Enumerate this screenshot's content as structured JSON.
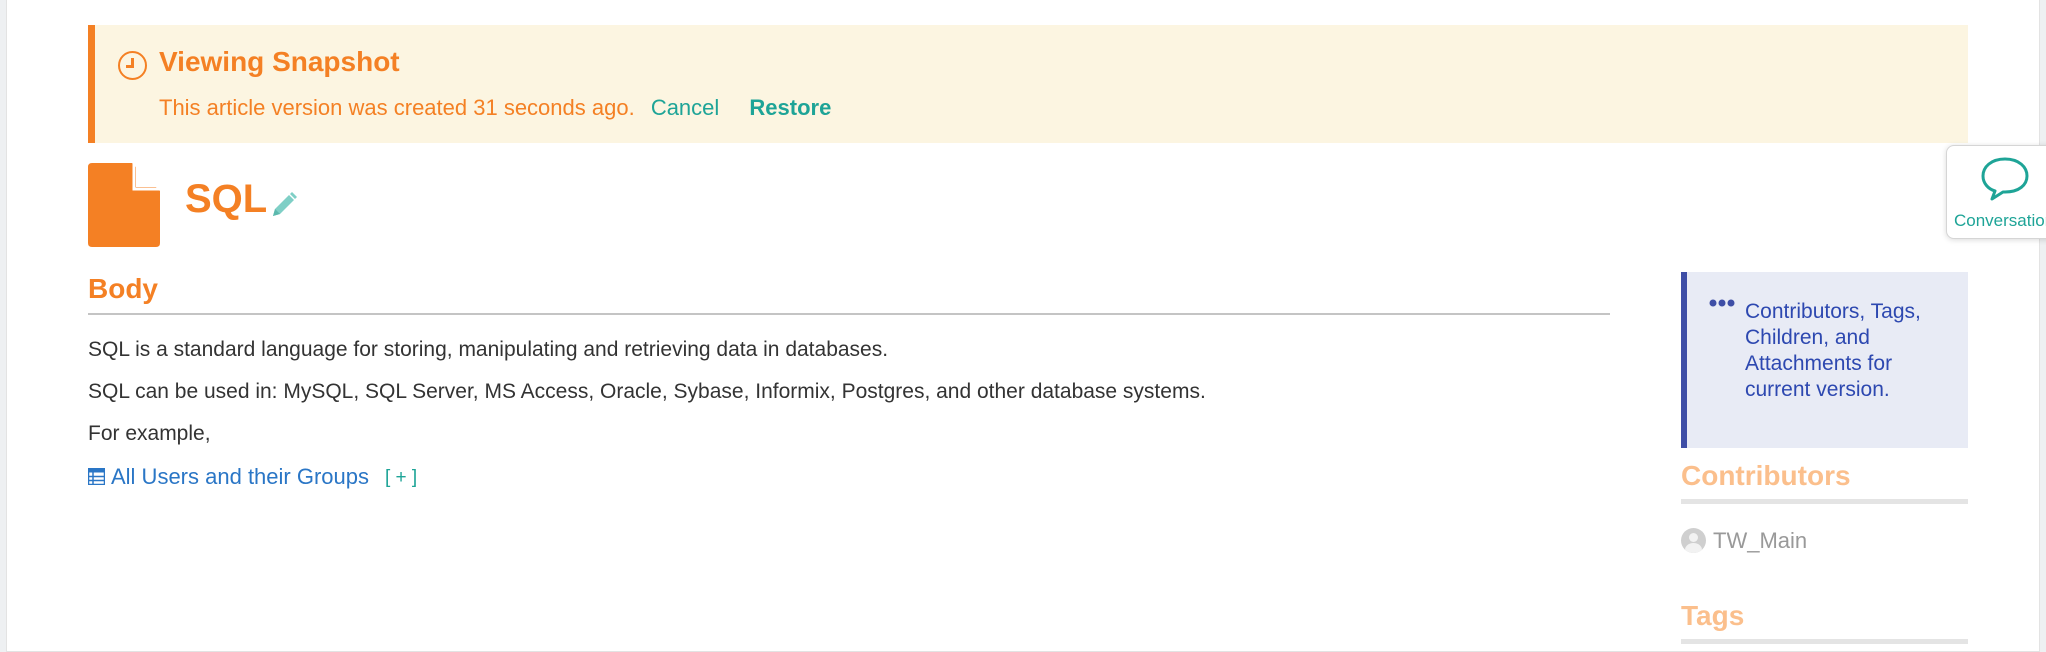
{
  "snapshot_banner": {
    "title": "Viewing Snapshot",
    "message": "This article version was created 31 seconds ago.",
    "cancel_label": "Cancel",
    "restore_label": "Restore",
    "icon": "clock-icon"
  },
  "article": {
    "title": "SQL",
    "type_icon": "document-icon",
    "edit_icon": "pencil-icon",
    "body_heading": "Body",
    "paragraphs": [
      "SQL is a standard language for storing, manipulating and retrieving data in databases.",
      "SQL can be used in: MySQL, SQL Server, MS Access, Oracle, Sybase, Informix, Postgres, and other database systems.",
      "For example,"
    ],
    "embedded_table": {
      "label": "All Users and their Groups",
      "toggle_label": "[ + ]",
      "icon": "table-icon"
    }
  },
  "sidebar": {
    "info_text": "Contributors, Tags, Children, and Attachments for current version.",
    "info_icon": "ellipsis-icon",
    "contributors_heading": "Contributors",
    "contributors": [
      "TW_Main"
    ],
    "tags_heading": "Tags"
  },
  "conversation_tab": {
    "label": "Conversation",
    "icon": "speech-bubble-icon"
  },
  "colors": {
    "accent": "#f48024",
    "link": "#2a76c6",
    "teal": "#1ea497",
    "banner_bg": "#fcf5e1",
    "info_bg": "#e8ebf5",
    "info_text": "#2d48b0"
  }
}
